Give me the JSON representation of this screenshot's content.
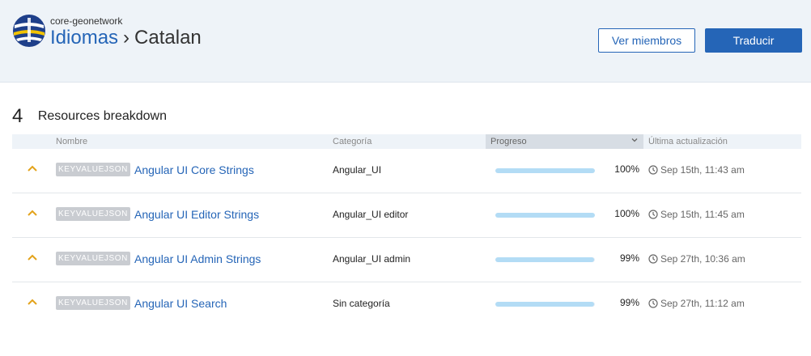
{
  "header": {
    "org": "core-geonetwork",
    "breadcrumb_link": "Idiomas",
    "breadcrumb_sep": "›",
    "breadcrumb_current": "Catalan",
    "members_button": "Ver miembros",
    "translate_button": "Traducir"
  },
  "section": {
    "count": "4",
    "title": "Resources breakdown"
  },
  "table": {
    "col_name": "Nombre",
    "col_category": "Categoría",
    "col_progress": "Progreso",
    "col_updated": "Última actualización"
  },
  "rows": [
    {
      "type": "KEYVALUEJSON",
      "name": "Angular UI Core Strings",
      "category": "Angular_UI",
      "progress_pct": 100,
      "progress_label": "100%",
      "updated": "Sep 15th, 11:43 am"
    },
    {
      "type": "KEYVALUEJSON",
      "name": "Angular UI Editor Strings",
      "category": "Angular_UI editor",
      "progress_pct": 100,
      "progress_label": "100%",
      "updated": "Sep 15th, 11:45 am"
    },
    {
      "type": "KEYVALUEJSON",
      "name": "Angular UI Admin Strings",
      "category": "Angular_UI admin",
      "progress_pct": 99,
      "progress_label": "99%",
      "updated": "Sep 27th, 10:36 am"
    },
    {
      "type": "KEYVALUEJSON",
      "name": "Angular UI Search",
      "category": "Sin categoría",
      "progress_pct": 99,
      "progress_label": "99%",
      "updated": "Sep 27th, 11:12 am"
    }
  ],
  "colors": {
    "link": "#2565b7",
    "caret": "#e3a21a",
    "progress": "#b3dcf5"
  },
  "icons": {
    "logo": "geonetwork-logo",
    "expand": "chevron-up-icon",
    "sort": "chevron-down-icon",
    "time": "clock-icon"
  }
}
